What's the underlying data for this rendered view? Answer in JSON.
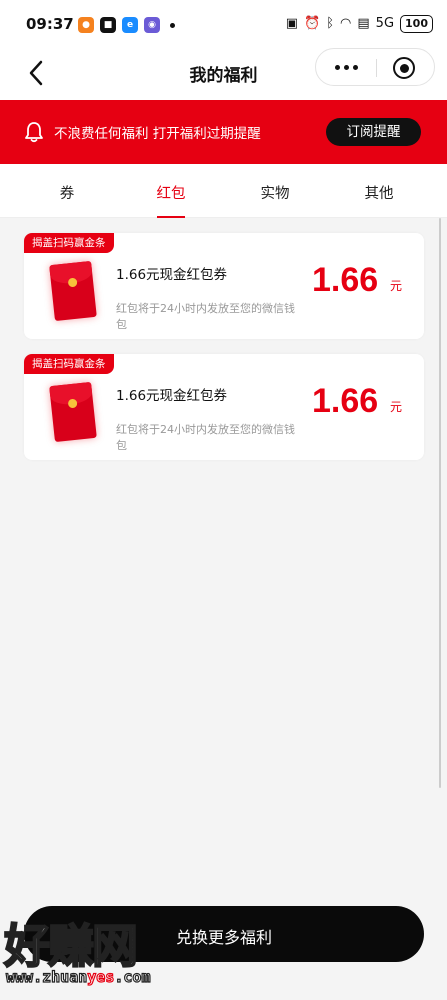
{
  "status_bar": {
    "time": "09:37",
    "battery": "100",
    "network": "5G"
  },
  "header": {
    "title": "我的福利"
  },
  "notice": {
    "text": "不浪费任何福利 打开福利过期提醒",
    "button": "订阅提醒"
  },
  "tabs": [
    {
      "label": "券",
      "active": false
    },
    {
      "label": "红包",
      "active": true
    },
    {
      "label": "实物",
      "active": false
    },
    {
      "label": "其他",
      "active": false
    }
  ],
  "cards": [
    {
      "tag": "揭盖扫码赢金条",
      "title": "1.66元现金红包券",
      "desc": "红包将于24小时内发放至您的微信钱包",
      "amount": "1.66",
      "unit": "元",
      "icon": "red-envelope-icon"
    },
    {
      "tag": "揭盖扫码赢金条",
      "title": "1.66元现金红包券",
      "desc": "红包将于24小时内发放至您的微信钱包",
      "amount": "1.66",
      "unit": "元",
      "icon": "red-envelope-icon"
    }
  ],
  "bottom_button": {
    "label": "兑换更多福利"
  },
  "watermark": {
    "big": "好赚网",
    "url_a": "www.zhuan",
    "url_b": "yes",
    "url_c": ".com"
  },
  "colors": {
    "accent": "#e60012",
    "dark": "#0a0a0a"
  }
}
